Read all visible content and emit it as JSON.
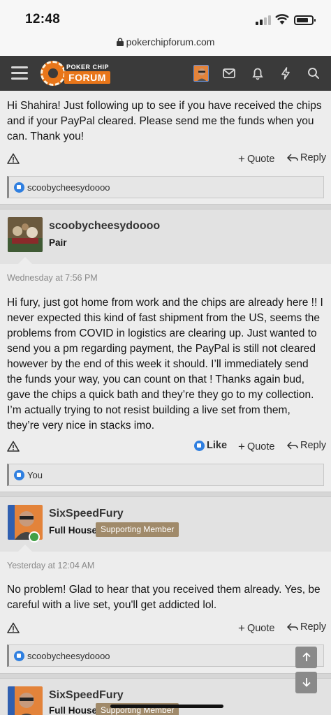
{
  "status_bar": {
    "time": "12:48"
  },
  "browser": {
    "url": "pokerchipforum.com"
  },
  "navbar": {
    "logo_top": "POKER CHIP",
    "logo_bottom": "FORUM"
  },
  "posts": [
    {
      "body": "Hi Shahira! Just following up to see if you have received the chips and if your PayPal cleared. Please send me the funds when you can. Thank you!",
      "actions": {
        "quote": "Quote",
        "reply": "Reply"
      },
      "reactions": "scoobycheesydoooo"
    },
    {
      "username": "scoobycheesydoooo",
      "user_title": "Pair",
      "date": "Wednesday at 7:56 PM",
      "body": "Hi fury, just got home from work and the chips are already here !! I never expected this kind of fast shipment from the US, seems the problems from COVID in logistics are clearing up. Just wanted to send you a pm regarding payment, the PayPal is still not cleared however by the end of this week it should. I’ll immediately send the funds your way, you can count on that ! Thanks again bud, gave the chips a quick bath and they’re they go to my collection. I’m actually trying to not resist building a live set from them, they’re very nice in stacks imo.",
      "actions": {
        "like": "Like",
        "quote": "Quote",
        "reply": "Reply"
      },
      "reactions": "You"
    },
    {
      "username": "SixSpeedFury",
      "user_title": "Full House",
      "badge": "Supporting Member",
      "date": "Yesterday at 12:04 AM",
      "body": "No problem! Glad to hear that you received them already. Yes, be careful with a live set, you'll get addicted lol.",
      "actions": {
        "quote": "Quote",
        "reply": "Reply"
      },
      "reactions": "scoobycheesydoooo"
    },
    {
      "username": "SixSpeedFury",
      "user_title": "Full House",
      "badge": "Supporting Member"
    }
  ],
  "colors": {
    "navbar": "#3a3a3a",
    "brand_orange": "#e8761a",
    "badge": "#a08a6a",
    "like_blue": "#2f7fe0"
  }
}
